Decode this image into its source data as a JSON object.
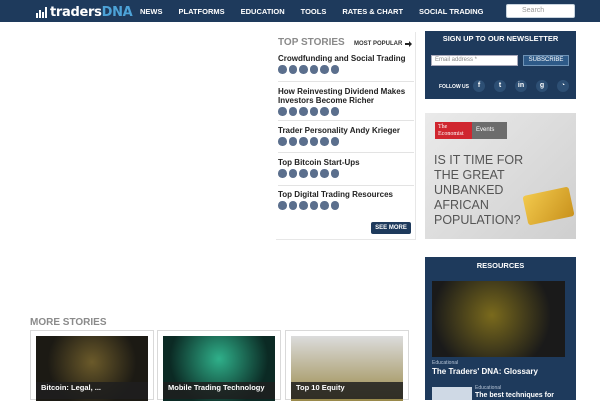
{
  "header": {
    "logo_part1": "traders",
    "logo_part2": "DNA",
    "nav": [
      "NEWS",
      "PLATFORMS",
      "EDUCATION",
      "TOOLS",
      "RATES & CHART",
      "SOCIAL TRADING"
    ],
    "search_placeholder": "Search"
  },
  "top_stories": {
    "heading": "TOP STORIES",
    "most_popular": "MOST POPULAR",
    "items": [
      {
        "title": "Crowdfunding and Social Trading"
      },
      {
        "title": "How Reinvesting Dividend Makes Investors Become Richer"
      },
      {
        "title": "Trader Personality Andy Krieger"
      },
      {
        "title": "Top Bitcoin Start-Ups"
      },
      {
        "title": "Top Digital Trading Resources"
      }
    ],
    "see_more": "SEE MORE"
  },
  "newsletter": {
    "heading": "SIGN UP TO OUR NEWSLETTER",
    "email_placeholder": "Email address *",
    "subscribe": "SUBSCRIBE",
    "follow_us": "FOLLOW US",
    "social_icons": [
      "facebook-icon",
      "twitter-icon",
      "linkedin-icon",
      "google-plus-icon",
      "rss-icon"
    ]
  },
  "ad": {
    "brand": "The Economist",
    "events": "Events",
    "headline": "IS IT TIME FOR THE GREAT UNBANKED AFRICAN POPULATION?"
  },
  "resources": {
    "heading": "RESOURCES",
    "tag1": "Educational",
    "title1": "The Traders' DNA: Glossary",
    "tag2": "Educational",
    "title2": "The best techniques for"
  },
  "more_stories": {
    "heading": "MORE STORIES",
    "cards": [
      {
        "caption": "Bitcoin: Legal, ..."
      },
      {
        "caption": "Mobile Trading Technology"
      },
      {
        "caption": "Top 10 Equity"
      }
    ]
  },
  "colors": {
    "navy": "#1e3a5c",
    "accent_blue": "#4da3d8"
  }
}
